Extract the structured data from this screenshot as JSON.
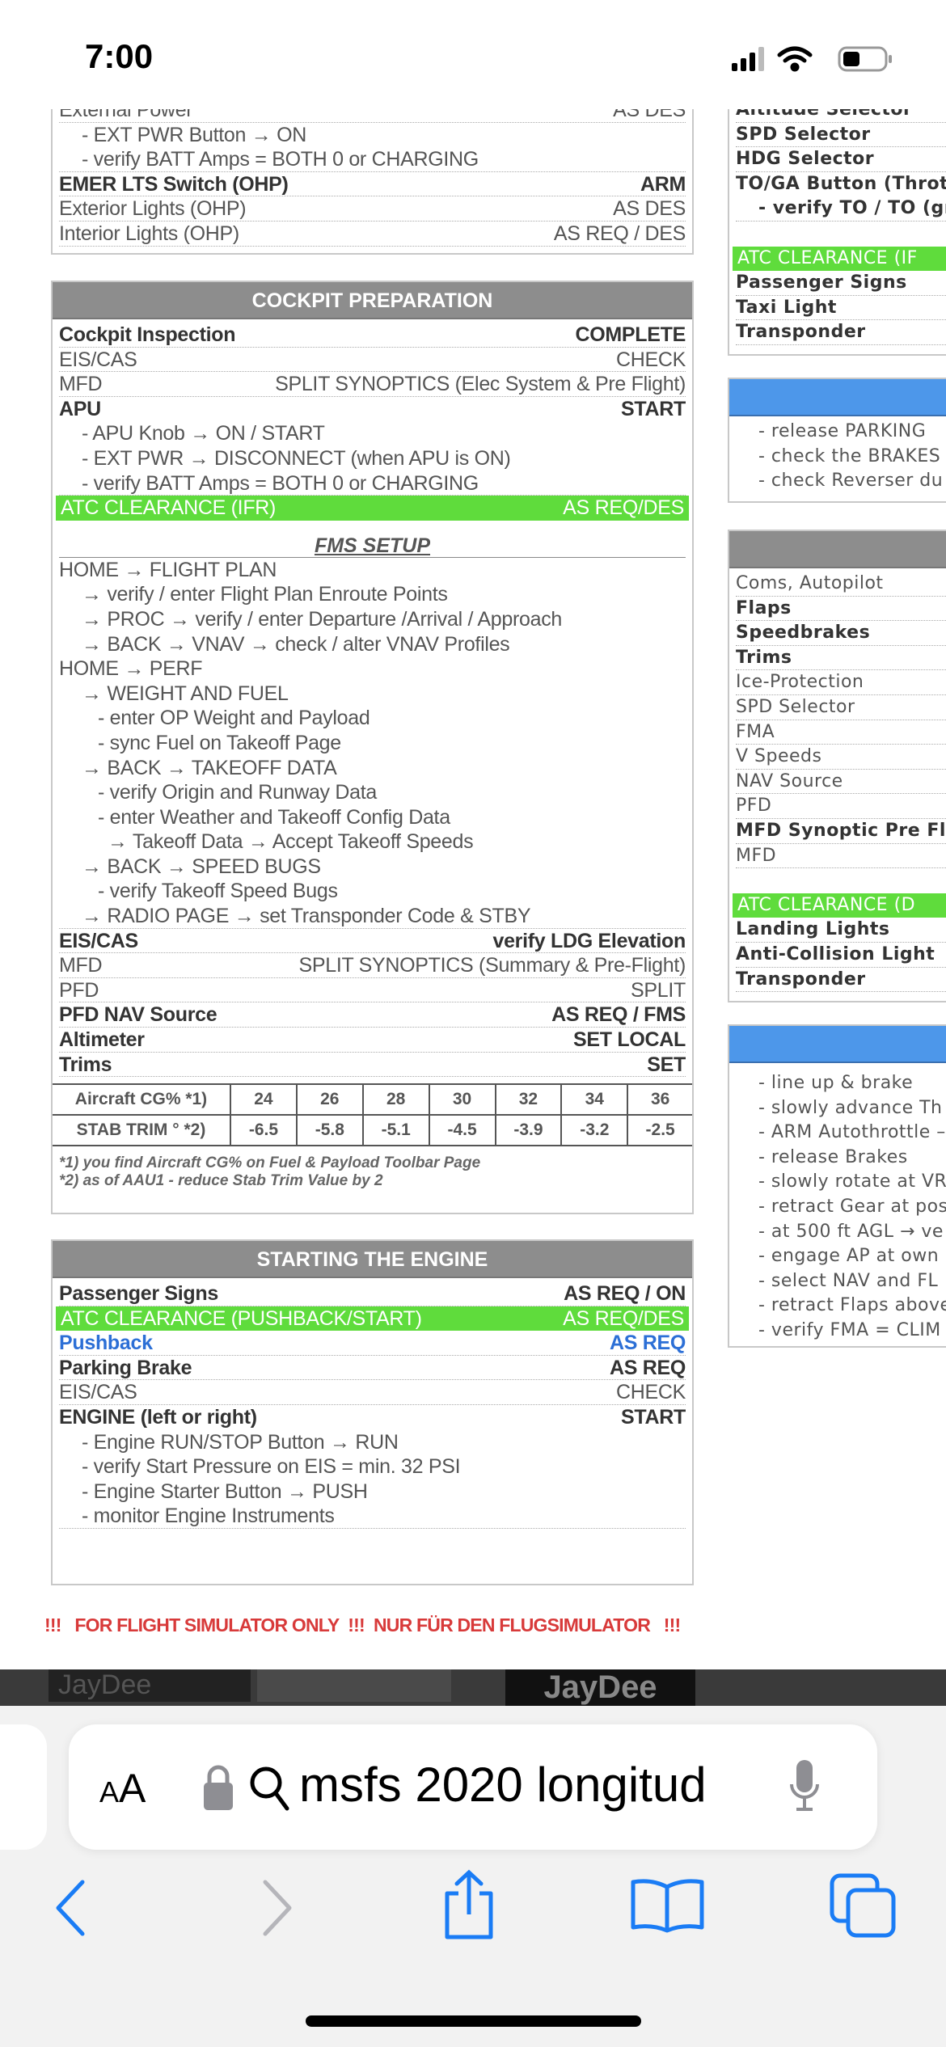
{
  "status_bar": {
    "time": "7:00",
    "icons": [
      "cellular-signal-icon",
      "wifi-icon",
      "battery-icon"
    ]
  },
  "left": {
    "top_box": {
      "rows": [
        {
          "label": "External Power",
          "value": "AS DES",
          "kind": "plain"
        },
        {
          "label": "- EXT PWR Button → ON",
          "value": "",
          "kind": "sub nb"
        },
        {
          "label": "- verify BATT Amps = BOTH 0 or CHARGING",
          "value": "",
          "kind": "sub"
        },
        {
          "label": "EMER LTS Switch (OHP)",
          "value": "ARM",
          "kind": "bold"
        },
        {
          "label": "Exterior Lights (OHP)",
          "value": "AS DES",
          "kind": "plain"
        },
        {
          "label": "Interior Lights (OHP)",
          "value": "AS REQ / DES",
          "kind": "plain"
        }
      ]
    },
    "cockpit_prep": {
      "title": "COCKPIT PREPARATION",
      "rows": [
        {
          "label": "Cockpit Inspection",
          "value": "COMPLETE",
          "kind": "bold"
        },
        {
          "label": "EIS/CAS",
          "value": "CHECK",
          "kind": "plain"
        },
        {
          "label": "MFD",
          "value": "SPLIT SYNOPTICS (Elec System & Pre Flight)",
          "kind": "plain"
        },
        {
          "label": "APU",
          "value": "START",
          "kind": "bold nb"
        },
        {
          "label": "- APU Knob → ON / START",
          "value": "",
          "kind": "sub nb"
        },
        {
          "label": "- EXT PWR → DISCONNECT (when APU is ON)",
          "value": "",
          "kind": "sub nb"
        },
        {
          "label": "- verify BATT Amps = BOTH 0 or CHARGING",
          "value": "",
          "kind": "sub"
        },
        {
          "label": "ATC CLEARANCE (IFR)",
          "value": "AS REQ/DES",
          "kind": "green"
        }
      ],
      "fms_title": "FMS SETUP",
      "fms_rows": [
        {
          "label": "HOME → FLIGHT PLAN",
          "value": "",
          "kind": "nb"
        },
        {
          "label": "→ verify / enter Flight Plan Enroute Points",
          "value": "",
          "kind": "sub nb"
        },
        {
          "label": "→ PROC → verify / enter Departure /Arrival / Approach",
          "value": "",
          "kind": "sub nb"
        },
        {
          "label": "→ BACK → VNAV → check / alter VNAV Profiles",
          "value": "",
          "kind": "sub nb"
        },
        {
          "label": "HOME → PERF",
          "value": "",
          "kind": "nb"
        },
        {
          "label": "→ WEIGHT AND FUEL",
          "value": "",
          "kind": "sub nb"
        },
        {
          "label": "- enter OP Weight and Payload",
          "value": "",
          "kind": "sub3 nb"
        },
        {
          "label": "- sync Fuel on Takeoff Page",
          "value": "",
          "kind": "sub3 nb"
        },
        {
          "label": "→ BACK → TAKEOFF DATA",
          "value": "",
          "kind": "sub nb"
        },
        {
          "label": "- verify Origin and Runway Data",
          "value": "",
          "kind": "sub3 nb"
        },
        {
          "label": "- enter Weather and Takeoff Config Data",
          "value": "",
          "kind": "sub3 nb"
        },
        {
          "label": "→ Takeoff Data → Accept Takeoff Speeds",
          "value": "",
          "kind": "sub2 nb"
        },
        {
          "label": "→ BACK → SPEED BUGS",
          "value": "",
          "kind": "sub nb"
        },
        {
          "label": "- verify Takeoff Speed Bugs",
          "value": "",
          "kind": "sub3 nb"
        },
        {
          "label": "→ RADIO PAGE → set Transponder Code & STBY",
          "value": "",
          "kind": "sub"
        },
        {
          "label": "EIS/CAS",
          "value": "verify LDG Elevation",
          "kind": "bold"
        },
        {
          "label": "MFD",
          "value": "SPLIT SYNOPTICS (Summary & Pre-Flight)",
          "kind": "plain"
        },
        {
          "label": "PFD",
          "value": "SPLIT",
          "kind": "plain"
        },
        {
          "label": "PFD NAV Source",
          "value": "AS REQ / FMS",
          "kind": "bold"
        },
        {
          "label": "Altimeter",
          "value": "SET LOCAL",
          "kind": "bold"
        },
        {
          "label": "Trims",
          "value": "SET",
          "kind": "bold"
        }
      ],
      "cg_table": {
        "rows": [
          {
            "header": "Aircraft CG% *1)",
            "values": [
              "24",
              "26",
              "28",
              "30",
              "32",
              "34",
              "36"
            ]
          },
          {
            "header": "STAB TRIM ° *2)",
            "values": [
              "-6.5",
              "-5.8",
              "-5.1",
              "-4.5",
              "-3.9",
              "-3.2",
              "-2.5"
            ]
          }
        ],
        "notes": [
          "*1) you find Aircraft CG% on Fuel & Payload Toolbar Page",
          "*2) as of AAU1 - reduce Stab Trim Value by 2"
        ]
      }
    },
    "starting_engine": {
      "title": "STARTING THE ENGINE",
      "rows": [
        {
          "label": "Passenger Signs",
          "value": "AS REQ / ON",
          "kind": "bold"
        },
        {
          "label": "ATC CLEARANCE (PUSHBACK/START)",
          "value": "AS REQ/DES",
          "kind": "green"
        },
        {
          "label": "Pushback",
          "value": "AS REQ",
          "kind": "blue"
        },
        {
          "label": "Parking Brake",
          "value": "AS REQ",
          "kind": "bold"
        },
        {
          "label": "EIS/CAS",
          "value": "CHECK",
          "kind": "plain"
        },
        {
          "label": "ENGINE (left or right)",
          "value": "START",
          "kind": "bold nb"
        },
        {
          "label": "- Engine RUN/STOP Button → RUN",
          "value": "",
          "kind": "sub nb"
        },
        {
          "label": "- verify Start Pressure on EIS = min. 32 PSI",
          "value": "",
          "kind": "sub nb"
        },
        {
          "label": "- Engine Starter Button → PUSH",
          "value": "",
          "kind": "sub nb"
        },
        {
          "label": "- monitor Engine Instruments",
          "value": "",
          "kind": "sub"
        }
      ]
    }
  },
  "right": {
    "top_box": {
      "rows": [
        {
          "label": "Altitude Selector",
          "value": "",
          "kind": "bold"
        },
        {
          "label": "SPD Selector",
          "value": "",
          "kind": "bold"
        },
        {
          "label": "HDG Selector",
          "value": "",
          "kind": "bold"
        },
        {
          "label": "TO/GA Button (Throt",
          "value": "",
          "kind": "bold nb"
        },
        {
          "label": "- verify TO / TO (gr",
          "value": "",
          "kind": "bold sub"
        },
        {
          "label": "",
          "value": "",
          "kind": "gap"
        },
        {
          "label": "ATC CLEARANCE (IF",
          "value": "",
          "kind": "green"
        },
        {
          "label": "Passenger Signs",
          "value": "",
          "kind": "bold"
        },
        {
          "label": "Taxi Light",
          "value": "",
          "kind": "bold"
        },
        {
          "label": "Transponder",
          "value": "",
          "kind": "bold"
        }
      ]
    },
    "blue_box_1": {
      "title": "",
      "rows": [
        {
          "label": "- release PARKING",
          "value": "",
          "kind": "sub nb"
        },
        {
          "label": "- check the BRAKES",
          "value": "",
          "kind": "sub nb"
        },
        {
          "label": "- check Reverser du",
          "value": "",
          "kind": "sub nb"
        }
      ]
    },
    "gray_box": {
      "title": "",
      "rows": [
        {
          "label": "Coms, Autopilot",
          "value": "",
          "kind": "plain"
        },
        {
          "label": "Flaps",
          "value": "",
          "kind": "bold"
        },
        {
          "label": "Speedbrakes",
          "value": "",
          "kind": "bold"
        },
        {
          "label": "Trims",
          "value": "",
          "kind": "bold"
        },
        {
          "label": "Ice-Protection",
          "value": "",
          "kind": "plain"
        },
        {
          "label": "SPD Selector",
          "value": "",
          "kind": "plain"
        },
        {
          "label": "FMA",
          "value": "",
          "kind": "plain"
        },
        {
          "label": "V Speeds",
          "value": "",
          "kind": "plain"
        },
        {
          "label": "NAV Source",
          "value": "",
          "kind": "plain"
        },
        {
          "label": "PFD",
          "value": "",
          "kind": "plain"
        },
        {
          "label": "MFD Synoptic Pre Fli",
          "value": "",
          "kind": "bold"
        },
        {
          "label": "MFD",
          "value": "",
          "kind": "plain"
        },
        {
          "label": "",
          "value": "",
          "kind": "gap"
        },
        {
          "label": "ATC CLEARANCE (D",
          "value": "",
          "kind": "green"
        },
        {
          "label": "Landing Lights",
          "value": "",
          "kind": "bold"
        },
        {
          "label": "Anti-Collision Light",
          "value": "",
          "kind": "bold"
        },
        {
          "label": "Transponder",
          "value": "",
          "kind": "bold"
        }
      ]
    },
    "blue_box_2": {
      "title": "",
      "rows": [
        {
          "label": "- line up & brake",
          "value": "",
          "kind": "sub nb"
        },
        {
          "label": "- slowly advance Th",
          "value": "",
          "kind": "sub nb"
        },
        {
          "label": "- ARM Autothrottle –",
          "value": "",
          "kind": "sub nb"
        },
        {
          "label": "- release Brakes",
          "value": "",
          "kind": "sub nb"
        },
        {
          "label": "- slowly rotate at VR",
          "value": "",
          "kind": "sub nb"
        },
        {
          "label": "- retract Gear at pos",
          "value": "",
          "kind": "sub nb"
        },
        {
          "label": "- at 500 ft AGL → ve",
          "value": "",
          "kind": "sub nb"
        },
        {
          "label": "- engage AP at own",
          "value": "",
          "kind": "sub nb"
        },
        {
          "label": "- select NAV and FL",
          "value": "",
          "kind": "sub nb"
        },
        {
          "label": "- retract Flaps above",
          "value": "",
          "kind": "sub nb"
        },
        {
          "label": "- verify FMA = CLIM",
          "value": "",
          "kind": "sub nb"
        }
      ]
    }
  },
  "footer_warning": "!!!   FOR FLIGHT SIMULATOR ONLY  !!!  NUR FÜR DEN FLUGSIMULATOR   !!!",
  "ad_strip": {
    "left_logo": "JayDee",
    "right_logo": "JayDee"
  },
  "browser": {
    "text_size_button": {
      "small": "A",
      "large": "A"
    },
    "url_text": "msfs 2020 longitud",
    "icons": [
      "lock-icon",
      "search-icon",
      "microphone-icon",
      "back-icon",
      "forward-icon",
      "share-icon",
      "bookmarks-icon",
      "tabs-icon"
    ]
  },
  "colors": {
    "green_highlight": "#5fdc3c",
    "blue_header": "#4d97ea",
    "gray_header": "#8d8d8d",
    "warning_red": "#d83a3a",
    "link_blue": "#2c6fd6"
  }
}
